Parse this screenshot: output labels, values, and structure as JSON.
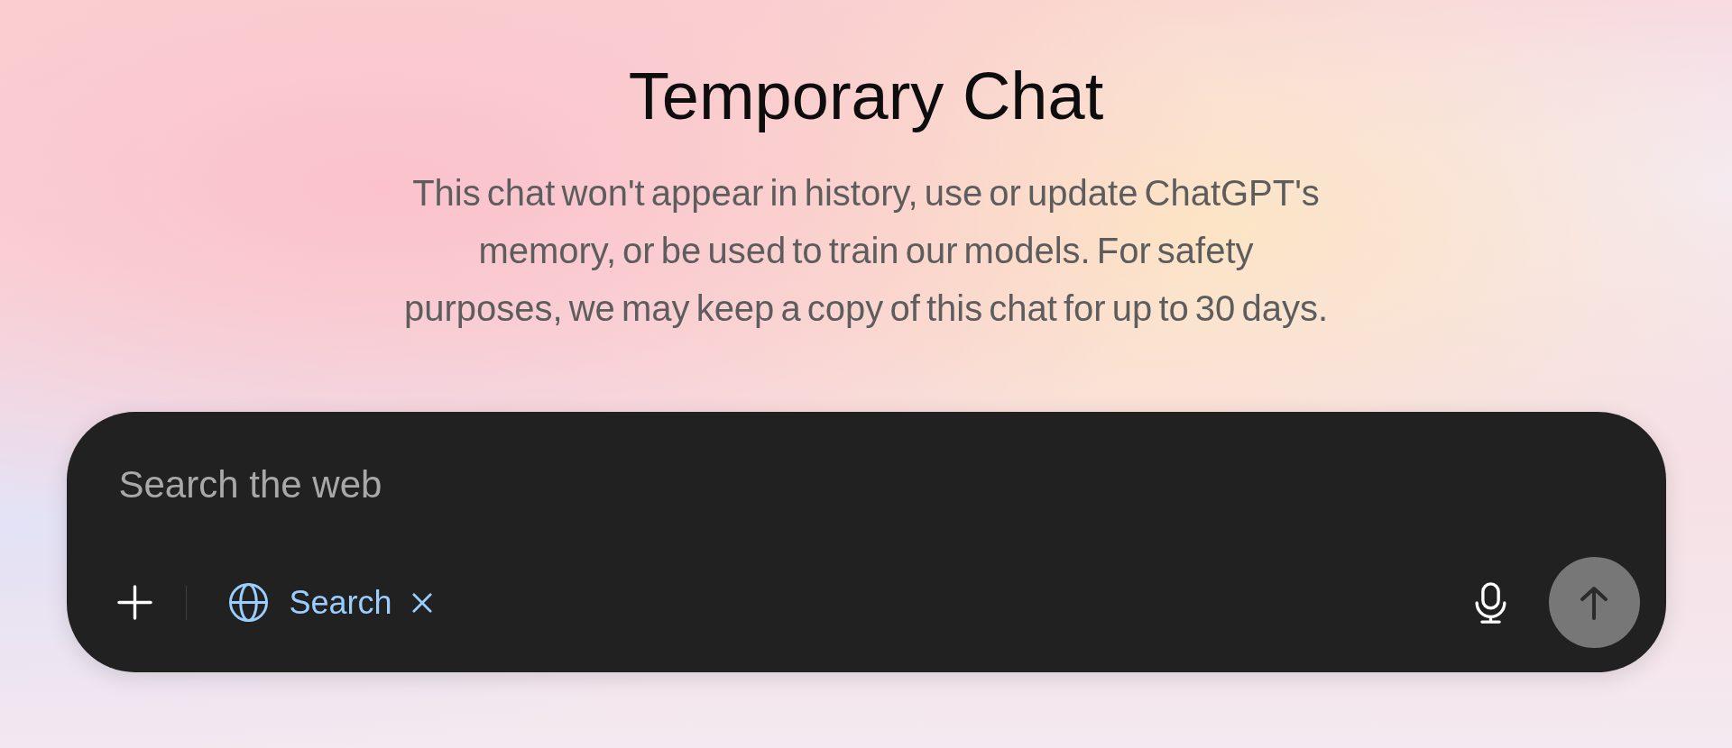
{
  "title": "Temporary Chat",
  "notice": "This chat won't appear in history, use or update ChatGPT's memory, or be used to train our models. For safety purposes, we may keep a copy of this chat for up to 30 days.",
  "composer": {
    "placeholder": "Search the web",
    "tools": [
      {
        "kind": "search",
        "label": "Search",
        "selected": true
      }
    ],
    "send_button": {
      "disabled": true
    }
  }
}
